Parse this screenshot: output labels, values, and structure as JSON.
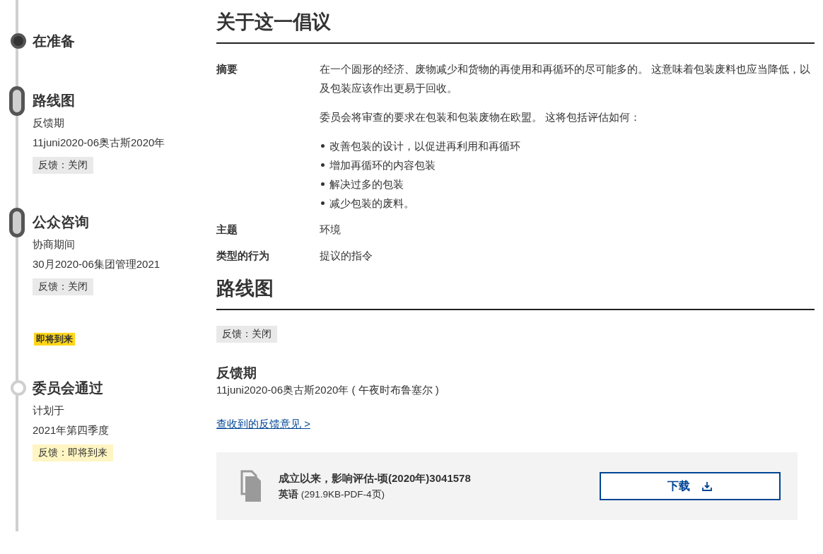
{
  "timeline": [
    {
      "title": "在准备",
      "kind": "dot",
      "upcoming": false
    },
    {
      "title": "路线图",
      "kind": "pill",
      "upcoming": false,
      "lines": [
        "反馈期",
        "11juni2020-06奥古斯2020年"
      ],
      "tag": {
        "text": "反馈：关闭",
        "kind": "closed"
      }
    },
    {
      "title": "公众咨询",
      "kind": "pill",
      "upcoming": false,
      "lines": [
        "协商期间",
        "30月2020-06集团管理2021"
      ],
      "tag": {
        "text": "反馈：关闭",
        "kind": "closed"
      }
    },
    {
      "flag": "即将到来",
      "title": "委员会通过",
      "kind": "dot",
      "upcoming": true,
      "lines": [
        "计划于",
        "2021年第四季度"
      ],
      "tag": {
        "text": "反馈：即将到来",
        "kind": "upcoming"
      }
    }
  ],
  "about": {
    "heading": "关于这一倡议",
    "rows": [
      {
        "label": "摘要",
        "paragraphs": [
          "在一个圆形的经济、废物减少和货物的再使用和再循环的尽可能多的。 这意味着包装废料也应当降低，以及包装应该作出更易于回收。",
          "委员会将审查的要求在包装和包装废物在欧盟。 这将包括评估如何："
        ],
        "bullets": [
          "改善包装的设计，以促进再利用和再循环",
          "增加再循环的内容包装",
          "解决过多的包装",
          "减少包装的废料。"
        ]
      },
      {
        "label": "主题",
        "paragraphs": [
          "环境"
        ],
        "bullets": []
      },
      {
        "label": "类型的行为",
        "paragraphs": [
          "提议的指令"
        ],
        "bullets": []
      }
    ]
  },
  "roadmap": {
    "heading": "路线图",
    "tag": {
      "text": "反馈：关闭",
      "kind": "closed"
    },
    "period_title": "反馈期",
    "period_text": "11juni2020-06奥古斯2020年 ( 午夜时布鲁塞尔 )",
    "link": "查收到的反馈意见 >",
    "document": {
      "title": "成立以来，影响评估-顷(2020年)3041578",
      "language": "英语",
      "meta": "(291.9KB-PDF-4页)",
      "button": "下载"
    }
  }
}
